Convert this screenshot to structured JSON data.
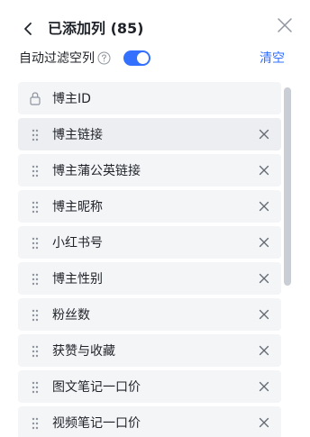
{
  "header": {
    "title": "已添加列 (85)",
    "back_icon": "chevron-left-icon",
    "close_icon": "close-icon"
  },
  "filter": {
    "label": "自动过滤空列",
    "help_icon": "question-circle-icon",
    "toggle_on": true,
    "clear_label": "清空"
  },
  "columns": [
    {
      "label": "博主ID",
      "locked": true
    },
    {
      "label": "博主链接",
      "locked": false
    },
    {
      "label": "博主蒲公英链接",
      "locked": false
    },
    {
      "label": "博主昵称",
      "locked": false
    },
    {
      "label": "小红书号",
      "locked": false
    },
    {
      "label": "博主性别",
      "locked": false
    },
    {
      "label": "粉丝数",
      "locked": false
    },
    {
      "label": "获赞与收藏",
      "locked": false
    },
    {
      "label": "图文笔记一口价",
      "locked": false
    },
    {
      "label": "视频笔记一口价",
      "locked": false
    }
  ],
  "colors": {
    "accent": "#3370ff",
    "item_bg": "#f4f5f7",
    "text": "#1f2329",
    "icon_gray": "#8f959e"
  }
}
